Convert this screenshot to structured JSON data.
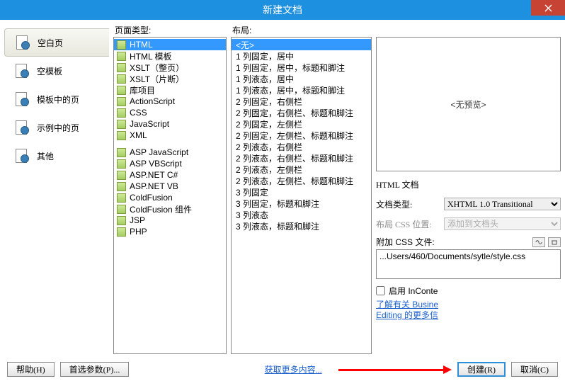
{
  "window": {
    "title": "新建文档",
    "close_icon": "close-icon"
  },
  "sidebar": {
    "items": [
      {
        "label": "空白页",
        "selected": true
      },
      {
        "label": "空模板"
      },
      {
        "label": "模板中的页"
      },
      {
        "label": "示例中的页"
      },
      {
        "label": "其他"
      }
    ]
  },
  "page_type": {
    "header": "页面类型:",
    "items": [
      "HTML",
      "HTML 模板",
      "XSLT（整页）",
      "XSLT（片断）",
      "库项目",
      "ActionScript",
      "CSS",
      "JavaScript",
      "XML",
      "",
      "ASP JavaScript",
      "ASP VBScript",
      "ASP.NET C#",
      "ASP.NET VB",
      "ColdFusion",
      "ColdFusion 组件",
      "JSP",
      "PHP"
    ],
    "selected": "HTML"
  },
  "layout": {
    "header": "布局:",
    "items": [
      "<无>",
      "1 列固定，居中",
      "1 列固定，居中，标题和脚注",
      "1 列液态，居中",
      "1 列液态，居中，标题和脚注",
      "2 列固定，右侧栏",
      "2 列固定，右侧栏、标题和脚注",
      "2 列固定，左侧栏",
      "2 列固定，左侧栏、标题和脚注",
      "2 列液态，右侧栏",
      "2 列液态，右侧栏、标题和脚注",
      "2 列液态，左侧栏",
      "2 列液态，左侧栏、标题和脚注",
      "3 列固定",
      "3 列固定，标题和脚注",
      "3 列液态",
      "3 列液态，标题和脚注"
    ],
    "selected": "<无>"
  },
  "preview": {
    "placeholder": "<无预览>",
    "doc_label": "HTML 文档"
  },
  "options": {
    "doctype_label": "文档类型:",
    "doctype_value": "XHTML 1.0 Transitional",
    "layoutcss_label": "布局 CSS 位置:",
    "layoutcss_value": "添加到文档头",
    "attachcss_label": "附加 CSS 文件:",
    "attachcss_value": "...Users/460/Documents/sytle/style.css",
    "enable_incontext_label": "启用 InConte",
    "link1": "了解有关 Busine",
    "link2": "Editing 的更多信"
  },
  "footer": {
    "help": "帮助(H)",
    "prefs": "首选参数(P)...",
    "more": "获取更多内容...",
    "create": "创建(R)",
    "cancel": "取消(C)"
  }
}
